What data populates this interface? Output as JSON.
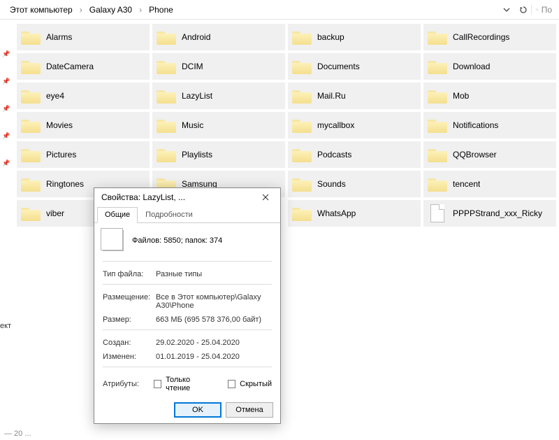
{
  "breadcrumb": {
    "a": "Этот компьютер",
    "b": "Galaxy A30",
    "c": "Phone"
  },
  "search": {
    "placeholder": "По"
  },
  "folders": [
    "Alarms",
    "Android",
    "backup",
    "CallRecordings",
    "DateCamera",
    "DCIM",
    "Documents",
    "Download",
    "eye4",
    "LazyList",
    "Mail.Ru",
    "Mob",
    "Movies",
    "Music",
    "mycallbox",
    "Notifications",
    "Pictures",
    "Playlists",
    "Podcasts",
    "QQBrowser",
    "Ringtones",
    "Samsung",
    "Sounds",
    "tencent",
    "viber",
    "",
    "WhatsApp",
    ""
  ],
  "file_last": "PPPPStrand_xxx_Ricky",
  "sidecut": "ект",
  "statusbar": "— 20 ...",
  "dialog": {
    "title": "Свойства: LazyList, ...",
    "tabs": {
      "general": "Общие",
      "details": "Подробности"
    },
    "summary": "Файлов: 5850; папок: 374",
    "rows": {
      "type_l": "Тип файла:",
      "type_v": "Разные типы",
      "loc_l": "Размещение:",
      "loc_v": "Все в Этот компьютер\\Galaxy A30\\Phone",
      "size_l": "Размер:",
      "size_v": "663 МБ (695 578 376,00 байт)",
      "created_l": "Создан:",
      "created_v": "29.02.2020 - 25.04.2020",
      "modified_l": "Изменен:",
      "modified_v": "01.01.2019 - 25.04.2020",
      "attr_l": "Атрибуты:",
      "ro": "Только чтение",
      "hidden": "Скрытый"
    },
    "ok": "OK",
    "cancel": "Отмена"
  }
}
